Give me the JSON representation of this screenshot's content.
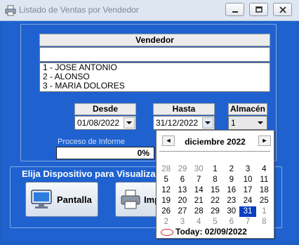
{
  "window": {
    "title": "Listado de Ventas por Vendedor",
    "controls": [
      "minimize",
      "restore",
      "close"
    ]
  },
  "vendedor": {
    "header": "Vendedor",
    "search_value": "",
    "items": [
      "1  - JOSE ANTONIO",
      "2  - ALONSO",
      "3  - MARIA DOLORES"
    ]
  },
  "desde": {
    "label": "Desde",
    "value": "01/08/2022"
  },
  "hasta": {
    "label": "Hasta",
    "value": "31/12/2022"
  },
  "almacen": {
    "label": "Almacén",
    "value": "1"
  },
  "progress": {
    "label": "Proceso de Informe",
    "text": "0%",
    "value": 0.0
  },
  "device": {
    "label": "Elija Dispositivo para Visualiza",
    "pantalla": "Pantalla",
    "impresora": "Imp"
  },
  "calendar": {
    "month_title": "diciembre 2022",
    "prev": "◄",
    "next": "►",
    "weeks": [
      [
        "28",
        "29",
        "30",
        "1",
        "2",
        "3",
        "4"
      ],
      [
        "5",
        "6",
        "7",
        "8",
        "9",
        "10",
        "11"
      ],
      [
        "12",
        "13",
        "14",
        "15",
        "16",
        "17",
        "18"
      ],
      [
        "19",
        "20",
        "21",
        "22",
        "23",
        "24",
        "25"
      ],
      [
        "26",
        "27",
        "28",
        "29",
        "30",
        "31",
        "1"
      ],
      [
        "2",
        "3",
        "4",
        "5",
        "6",
        "7",
        "8"
      ]
    ],
    "other_month_rows": [
      [
        0,
        1,
        2
      ],
      [],
      [],
      [],
      [
        6
      ],
      [
        0,
        1,
        2,
        3,
        4,
        5,
        6
      ]
    ],
    "selected": "31",
    "today_label": "Today: 02/09/2022"
  },
  "colors": {
    "window_bg": "#1f62cf",
    "selection": "#0a3fbf",
    "progress_label": "#cfe0ff"
  }
}
